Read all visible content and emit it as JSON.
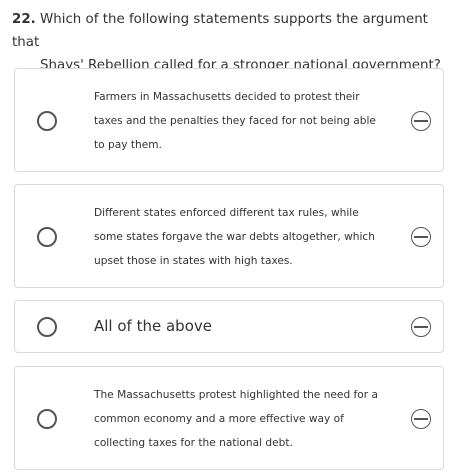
{
  "question": {
    "number": "22.",
    "line1": "Which of the following statements supports the argument that",
    "line2": "Shays' Rebellion called for a stronger national government?"
  },
  "options": [
    {
      "lines": [
        "Farmers in Massachusetts decided to protest their",
        "taxes and the penalties they faced for not being able",
        "to pay them."
      ],
      "selected": false
    },
    {
      "lines": [
        "Different states enforced different tax rules, while",
        "some states forgave the war debts altogether, which",
        "upset those in states with high taxes."
      ],
      "selected": false
    },
    {
      "lines": [
        "All of the above"
      ],
      "selected": false
    },
    {
      "lines": [
        "The Massachusetts protest highlighted the need for a",
        "common economy and a more effective way of",
        "collecting taxes for the national debt."
      ],
      "selected": false
    }
  ],
  "icons": {
    "radio": "radio-button-icon",
    "eliminate": "eliminate-option-icon"
  },
  "colors": {
    "text": "#333333",
    "border": "#d9d9d9",
    "icon": "#555555"
  }
}
